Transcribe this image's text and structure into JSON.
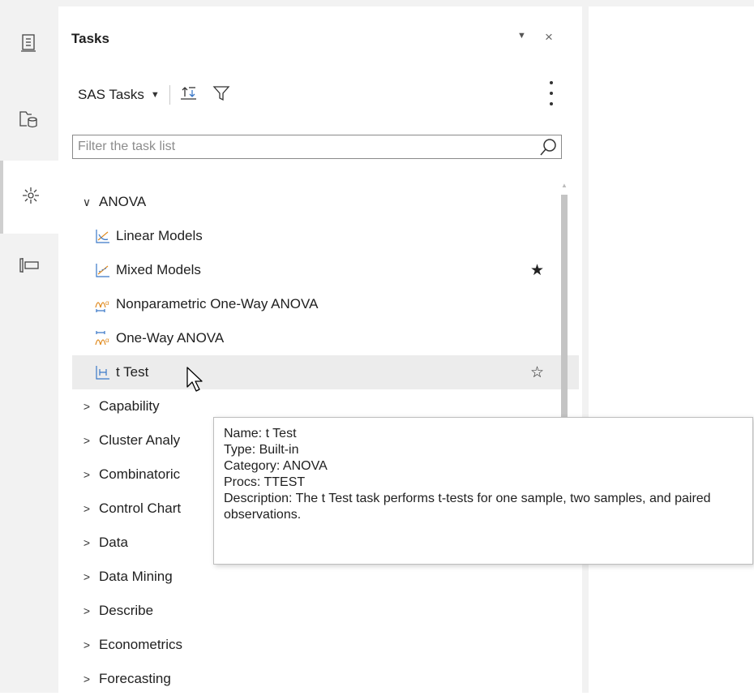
{
  "panel": {
    "title": "Tasks",
    "menu_glyph": "▼",
    "close_glyph": "×"
  },
  "toolbar": {
    "source_label": "SAS Tasks",
    "source_arrow": "▼",
    "sort_icon": "sort-icon",
    "filter_icon": "filter-icon",
    "more_icon": "kebab-menu-icon"
  },
  "filter": {
    "value": "",
    "placeholder": "Filter the task list"
  },
  "tree": {
    "groups": [
      {
        "label": "ANOVA",
        "expanded": true
      },
      {
        "label": "Capability"
      },
      {
        "label": "Cluster Analy"
      },
      {
        "label": "Combinatoric"
      },
      {
        "label": "Control Chart"
      },
      {
        "label": "Data"
      },
      {
        "label": "Data Mining"
      },
      {
        "label": "Describe"
      },
      {
        "label": "Econometrics"
      },
      {
        "label": "Forecasting"
      }
    ],
    "anova_items": [
      {
        "label": "Linear Models",
        "icon": "linear-models-icon"
      },
      {
        "label": "Mixed Models",
        "icon": "mixed-models-icon",
        "favorite": true
      },
      {
        "label": "Nonparametric One-Way ANOVA",
        "icon": "nonparametric-anova-icon"
      },
      {
        "label": "One-Way ANOVA",
        "icon": "one-way-anova-icon"
      },
      {
        "label": "t Test",
        "icon": "t-test-icon",
        "favorite": false
      }
    ],
    "expanded_glyph": "∨",
    "collapsed_glyph": ">"
  },
  "star_filled": "★",
  "star_empty": "☆",
  "tooltip": {
    "name": "Name: t Test",
    "type": "Type: Built-in",
    "category": "Category: ANOVA",
    "procs": "Procs: TTEST",
    "description": "Description: The t Test task performs t-tests for one sample, two samples, and paired observations."
  },
  "colors": {
    "rail_bg": "#f2f2f2",
    "hover_bg": "#ececec",
    "icon_blue": "#3a78c8",
    "icon_orange": "#e08a1e"
  }
}
